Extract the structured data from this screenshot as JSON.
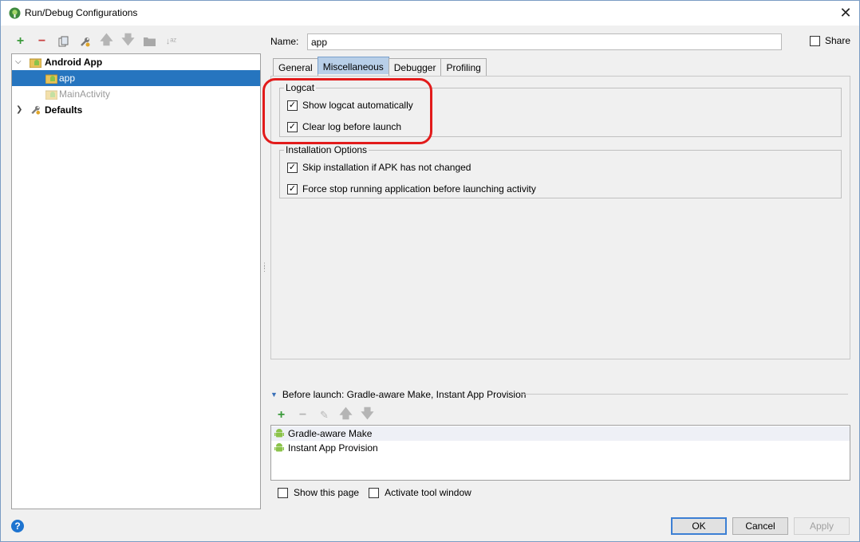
{
  "window": {
    "title": "Run/Debug Configurations",
    "close_glyph": "✕"
  },
  "left_toolbar": {
    "icons": [
      "add-icon",
      "remove-icon",
      "copy-icon",
      "wrench-icon",
      "move-up-icon",
      "move-down-icon",
      "folder-icon",
      "sort-icon"
    ]
  },
  "tree": {
    "items": [
      {
        "label": "Android App",
        "bold": true,
        "expanded": true
      },
      {
        "label": "app",
        "selected": true
      },
      {
        "label": "MainActivity",
        "disabled": true
      },
      {
        "label": "Defaults",
        "bold": true,
        "expanded": false
      }
    ]
  },
  "form": {
    "name_label": "Name:",
    "name_value": "app",
    "share_label": "Share",
    "share_checked": false
  },
  "tabs": [
    {
      "label": "General",
      "active": false
    },
    {
      "label": "Miscellaneous",
      "active": true
    },
    {
      "label": "Debugger",
      "active": false
    },
    {
      "label": "Profiling",
      "active": false
    }
  ],
  "logcat": {
    "title": "Logcat",
    "options": [
      {
        "label": "Show logcat automatically",
        "checked": true
      },
      {
        "label": "Clear log before launch",
        "checked": true
      }
    ]
  },
  "installation": {
    "title": "Installation Options",
    "options": [
      {
        "label": "Skip installation if APK has not changed",
        "checked": true
      },
      {
        "label": "Force stop running application before launching activity",
        "checked": true
      }
    ]
  },
  "before_launch": {
    "header": "Before launch: Gradle-aware Make, Instant App Provision",
    "toolbar_icons": [
      "add-icon",
      "remove-icon",
      "edit-icon",
      "move-up-icon",
      "move-down-icon"
    ],
    "tasks": [
      {
        "label": "Gradle-aware Make"
      },
      {
        "label": "Instant App Provision"
      }
    ]
  },
  "bottom_options": [
    {
      "label": "Show this page",
      "checked": false
    },
    {
      "label": "Activate tool window",
      "checked": false
    }
  ],
  "buttons": {
    "ok": "OK",
    "cancel": "Cancel",
    "apply": "Apply",
    "help": "?"
  },
  "colors": {
    "selection": "#2675bf",
    "highlight_ring": "#e21b1b",
    "android_green": "#8bc34a",
    "add_green": "#3a9a3a",
    "remove_red": "#c94040"
  }
}
